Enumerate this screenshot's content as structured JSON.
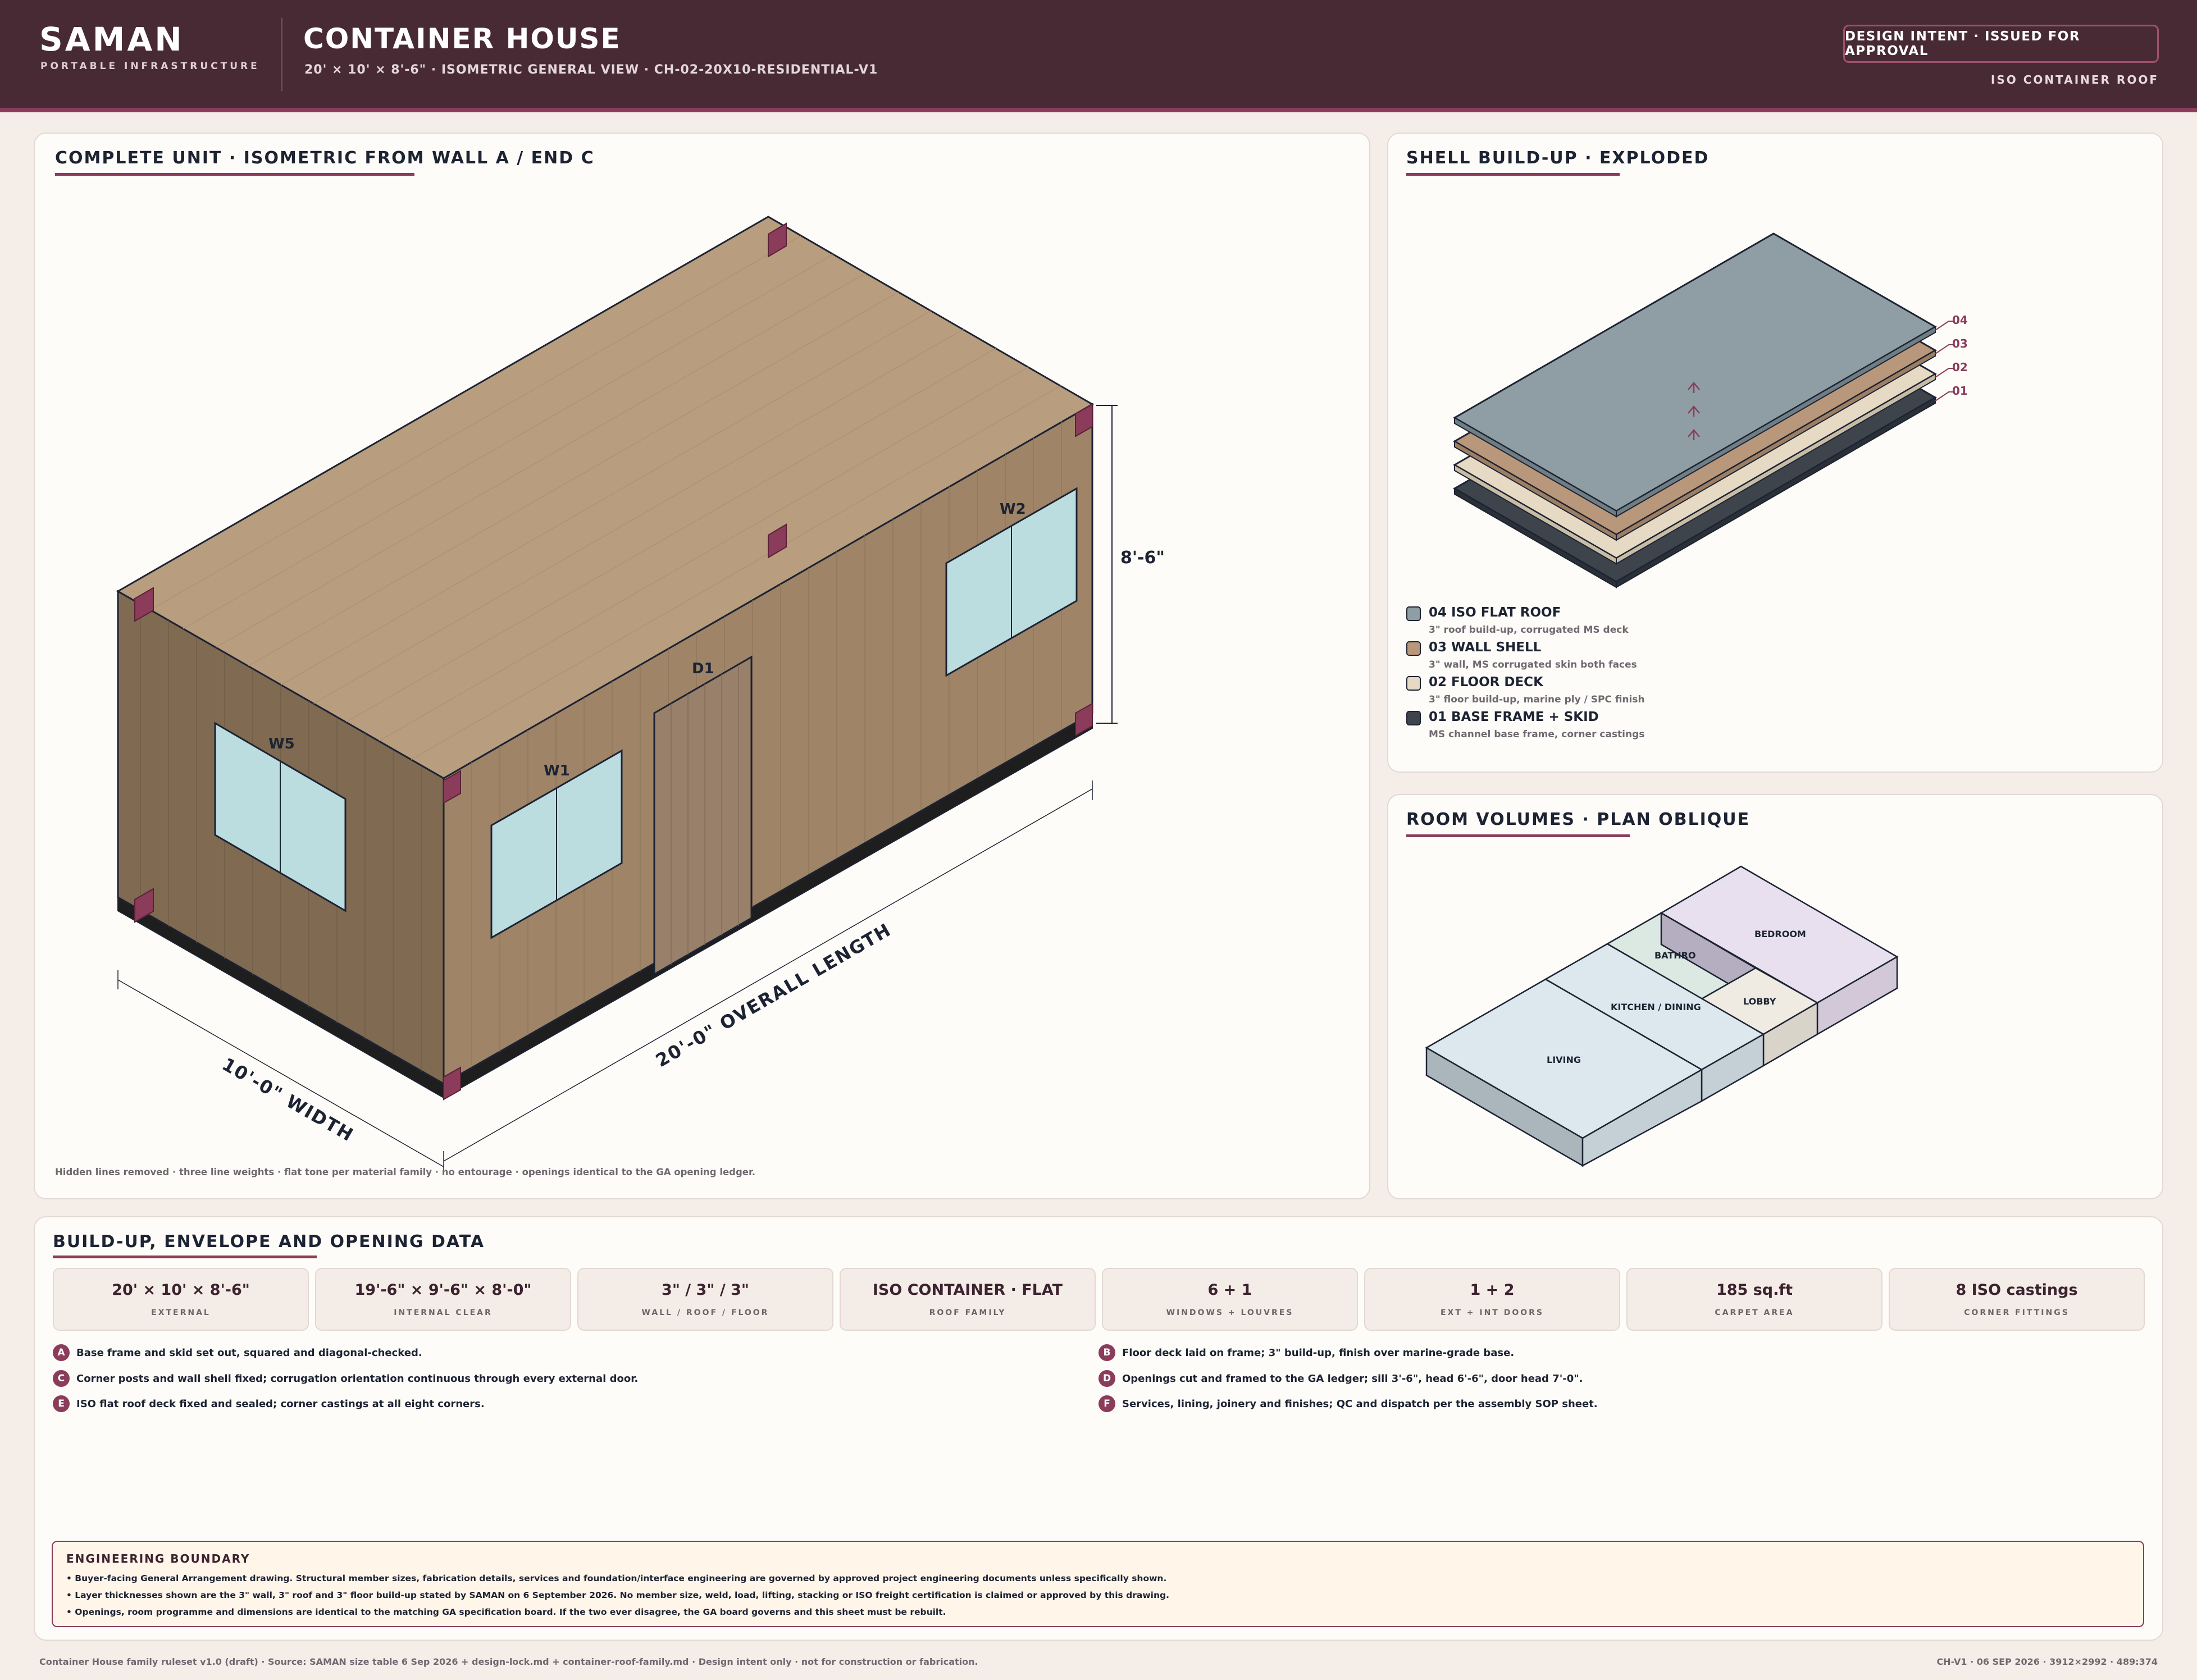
{
  "header": {
    "brand": "SAMAN",
    "brand_sub": "PORTABLE INFRASTRUCTURE",
    "title": "CONTAINER HOUSE",
    "subtitle": "20' × 10' × 8'-6\" · ISOMETRIC GENERAL VIEW · CH-02-20X10-RESIDENTIAL-V1",
    "status": "DESIGN INTENT · ISSUED FOR APPROVAL",
    "roof_tag": "ISO CONTAINER ROOF"
  },
  "iso_view": {
    "title": "COMPLETE UNIT · ISOMETRIC FROM WALL A / END C",
    "labels": {
      "w5": "W5",
      "w1": "W1",
      "d1": "D1",
      "w2": "W2"
    },
    "dims": {
      "height": "8'-6\"",
      "length": "20'-0\" OVERALL LENGTH",
      "width": "10'-0\" WIDTH"
    },
    "note": "Hidden lines removed · three line weights · flat tone per material family · no entourage · openings identical to the GA opening ledger."
  },
  "exploded": {
    "title": "SHELL BUILD-UP · EXPLODED",
    "layers": [
      {
        "num": "04",
        "name": "04 ISO FLAT ROOF",
        "desc": "3\" roof build-up, corrugated MS deck",
        "color": "#8f9ea4"
      },
      {
        "num": "03",
        "name": "03 WALL SHELL",
        "desc": "3\" wall, MS corrugated skin both faces",
        "color": "#b8977a"
      },
      {
        "num": "02",
        "name": "02 FLOOR DECK",
        "desc": "3\" floor build-up, marine ply / SPC finish",
        "color": "#e6dac4"
      },
      {
        "num": "01",
        "name": "01 BASE FRAME + SKID",
        "desc": "MS channel base frame, corner castings",
        "color": "#3d444c"
      }
    ]
  },
  "rooms": {
    "title": "ROOM VOLUMES · PLAN OBLIQUE",
    "labels": {
      "living": "LIVING",
      "kitchen": "KITCHEN / DINING",
      "bath": "BATHRO",
      "bedroom": "BEDROOM",
      "lobby": "LOBBY"
    }
  },
  "data": {
    "title": "BUILD-UP, ENVELOPE AND OPENING DATA",
    "cards": [
      {
        "value": "20' × 10' × 8'-6\"",
        "label": "EXTERNAL"
      },
      {
        "value": "19'-6\" × 9'-6\" × 8'-0\"",
        "label": "INTERNAL CLEAR"
      },
      {
        "value": "3\" / 3\" / 3\"",
        "label": "WALL / ROOF / FLOOR"
      },
      {
        "value": "ISO CONTAINER · FLAT",
        "label": "ROOF FAMILY"
      },
      {
        "value": "6 + 1",
        "label": "WINDOWS + LOUVRES"
      },
      {
        "value": "1 + 2",
        "label": "EXT + INT DOORS"
      },
      {
        "value": "185 sq.ft",
        "label": "CARPET AREA"
      },
      {
        "value": "8 ISO castings",
        "label": "CORNER FITTINGS"
      }
    ],
    "steps": [
      {
        "badge": "A",
        "text": "Base frame and skid set out, squared and diagonal-checked."
      },
      {
        "badge": "B",
        "text": "Floor deck laid on frame; 3\" build-up, finish over marine-grade base."
      },
      {
        "badge": "C",
        "text": "Corner posts and wall shell fixed; corrugation orientation continuous through every external door."
      },
      {
        "badge": "D",
        "text": "Openings cut and framed to the GA ledger; sill 3'-6\", head 6'-6\", door head 7'-0\"."
      },
      {
        "badge": "E",
        "text": "ISO flat roof deck fixed and sealed; corner castings at all eight corners."
      },
      {
        "badge": "F",
        "text": "Services, lining, joinery and finishes; QC and dispatch per the assembly SOP sheet."
      }
    ]
  },
  "engineering": {
    "title": "ENGINEERING BOUNDARY",
    "lines": [
      "• Buyer-facing General Arrangement drawing. Structural member sizes, fabrication details, services and foundation/interface engineering are governed by approved project engineering documents unless specifically shown.",
      "• Layer thicknesses shown are the 3\" wall, 3\" roof and 3\" floor build-up stated by SAMAN on 6 September 2026. No member size, weld, load, lifting, stacking or ISO freight certification is claimed or approved by this drawing.",
      "• Openings, room programme and dimensions are identical to the matching GA specification board. If the two ever disagree, the GA board governs and this sheet must be rebuilt."
    ]
  },
  "footer": {
    "left": "Container House family ruleset v1.0 (draft) · Source: SAMAN size table 6 Sep 2026 + design-lock.md + container-roof-family.md · Design intent only · not for construction or fabrication.",
    "right": "CH-V1 · 06 SEP 2026 · 3912×2992 · 489:374"
  }
}
